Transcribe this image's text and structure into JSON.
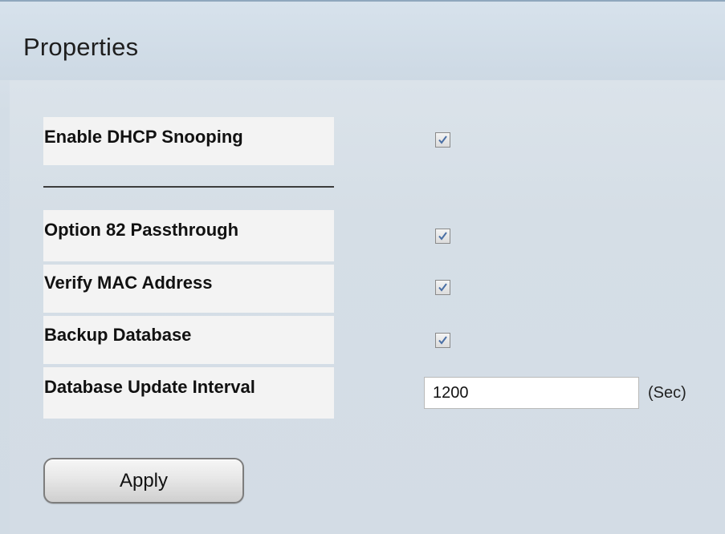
{
  "header": {
    "title": "Properties"
  },
  "form": {
    "enable_dhcp_snooping": {
      "label": "Enable DHCP Snooping",
      "checked": true
    },
    "option82_passthrough": {
      "label": "Option 82 Passthrough",
      "checked": true
    },
    "verify_mac_address": {
      "label": "Verify MAC Address",
      "checked": true
    },
    "backup_database": {
      "label": "Backup Database",
      "checked": true
    },
    "database_update_interval": {
      "label": "Database Update Interval",
      "value": "1200",
      "unit": "(Sec)"
    }
  },
  "actions": {
    "apply_label": "Apply"
  },
  "colors": {
    "checkmark": "#4a6fa5",
    "label_background": "#f3f3f3",
    "panel_background": "#d3dce5"
  },
  "icons": {
    "checkmark": "checkmark-icon"
  }
}
